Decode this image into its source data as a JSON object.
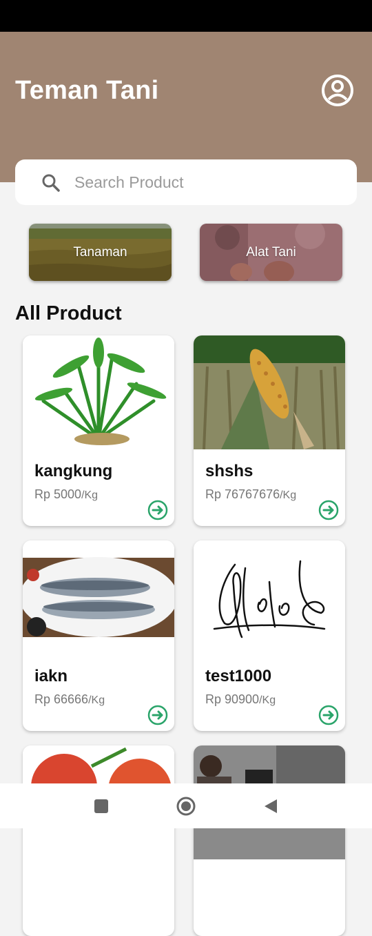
{
  "app": {
    "title": "Teman Tani",
    "header_color": "#a08572",
    "accent_color": "#2aa46a"
  },
  "search": {
    "placeholder": "Search Product",
    "value": ""
  },
  "categories": [
    {
      "label": "Tanaman",
      "image": "rice-field-photo"
    },
    {
      "label": "Alat Tani",
      "image": "farm-tools-photo"
    }
  ],
  "section": {
    "title": "All Product"
  },
  "products": [
    {
      "name": "kangkung",
      "price": "Rp 5000",
      "unit": "/Kg",
      "image": "water-spinach-photo"
    },
    {
      "name": "shshs",
      "price": "Rp 76767676",
      "unit": "/Kg",
      "image": "corn-field-photo"
    },
    {
      "name": "iakn",
      "price": "Rp 66666",
      "unit": "/Kg",
      "image": "fish-plate-photo"
    },
    {
      "name": "test1000",
      "price": "Rp 90900",
      "unit": "/Kg",
      "image": "signature-image"
    },
    {
      "name": "",
      "price": "",
      "unit": "",
      "image": "tomato-photo"
    },
    {
      "name": "",
      "price": "",
      "unit": "",
      "image": "person-photo"
    }
  ],
  "icons": {
    "profile": "account-circle-icon",
    "search": "search-icon",
    "card_action": "arrow-circle-right-icon",
    "nav_recents": "square-icon",
    "nav_home": "circle-icon",
    "nav_back": "triangle-back-icon"
  }
}
